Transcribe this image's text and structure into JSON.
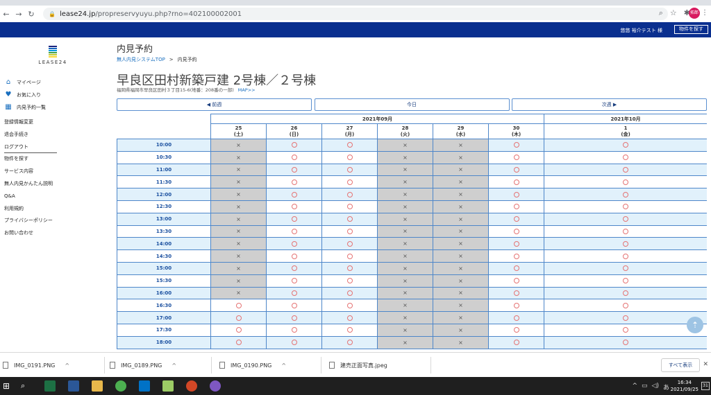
{
  "browser": {
    "url_host": "lease24.jp",
    "url_path": "/propreservyuyu.php?rno=402100002001",
    "profile_initials": "拓郎"
  },
  "site_header": {
    "user_text": "悠悠 裕介テスト 様",
    "search_button": "物件を探す"
  },
  "logo": {
    "text": "LEASE24",
    "colors": [
      "#1a237e",
      "#1565c0",
      "#039be5",
      "#43a047",
      "#c0ca33",
      "#fdd835"
    ]
  },
  "sidebar": {
    "main_items": [
      {
        "label": "マイページ",
        "icon": "home-icon"
      },
      {
        "label": "お気に入り",
        "icon": "heart-icon"
      },
      {
        "label": "内見予約一覧",
        "icon": "building-icon"
      }
    ],
    "links": [
      "登録情報変更",
      "退会手続き",
      "ログアウト",
      "物件を探す",
      "サービス内容",
      "無人内見かんたん説明",
      "Q&A",
      "利用規約",
      "プライバシーポリシー",
      "お問い合わせ"
    ]
  },
  "page": {
    "title": "内見予約",
    "breadcrumb": [
      {
        "label": "無人内見システムTOP"
      },
      {
        "label": "内見予約"
      }
    ],
    "breadcrumb_sep": ">",
    "property_title": "早良区田村新築戸建 2号棟／２号棟",
    "address": "福岡県福岡市早良区田村３丁目15-6(地番：208番の一部)",
    "map_link": "MAP>>"
  },
  "week_nav": {
    "prev": "◀ 前週",
    "today": "今日",
    "next": "次週 ▶"
  },
  "schedule": {
    "months": [
      {
        "label": "2021年09月",
        "span": 6
      },
      {
        "label": "2021年10月",
        "span": 1
      }
    ],
    "days": [
      {
        "date": "25",
        "dow": "(土)"
      },
      {
        "date": "26",
        "dow": "(日)"
      },
      {
        "date": "27",
        "dow": "(月)"
      },
      {
        "date": "28",
        "dow": "(火)"
      },
      {
        "date": "29",
        "dow": "(水)"
      },
      {
        "date": "30",
        "dow": "(木)"
      },
      {
        "date": "1",
        "dow": "(金)"
      }
    ],
    "available_mark": "○",
    "unavailable_mark": "×",
    "rows": [
      {
        "time": "10:00",
        "slots": [
          "x",
          "o",
          "o",
          "x",
          "x",
          "o",
          "o"
        ]
      },
      {
        "time": "10:30",
        "slots": [
          "x",
          "o",
          "o",
          "x",
          "x",
          "o",
          "o"
        ]
      },
      {
        "time": "11:00",
        "slots": [
          "x",
          "o",
          "o",
          "x",
          "x",
          "o",
          "o"
        ]
      },
      {
        "time": "11:30",
        "slots": [
          "x",
          "o",
          "o",
          "x",
          "x",
          "o",
          "o"
        ]
      },
      {
        "time": "12:00",
        "slots": [
          "x",
          "o",
          "o",
          "x",
          "x",
          "o",
          "o"
        ]
      },
      {
        "time": "12:30",
        "slots": [
          "x",
          "o",
          "o",
          "x",
          "x",
          "o",
          "o"
        ]
      },
      {
        "time": "13:00",
        "slots": [
          "x",
          "o",
          "o",
          "x",
          "x",
          "o",
          "o"
        ]
      },
      {
        "time": "13:30",
        "slots": [
          "x",
          "o",
          "o",
          "x",
          "x",
          "o",
          "o"
        ]
      },
      {
        "time": "14:00",
        "slots": [
          "x",
          "o",
          "o",
          "x",
          "x",
          "o",
          "o"
        ]
      },
      {
        "time": "14:30",
        "slots": [
          "x",
          "o",
          "o",
          "x",
          "x",
          "o",
          "o"
        ]
      },
      {
        "time": "15:00",
        "slots": [
          "x",
          "o",
          "o",
          "x",
          "x",
          "o",
          "o"
        ]
      },
      {
        "time": "15:30",
        "slots": [
          "x",
          "o",
          "o",
          "x",
          "x",
          "o",
          "o"
        ]
      },
      {
        "time": "16:00",
        "slots": [
          "x",
          "o",
          "o",
          "x",
          "x",
          "o",
          "o"
        ]
      },
      {
        "time": "16:30",
        "slots": [
          "o",
          "o",
          "o",
          "x",
          "x",
          "o",
          "o"
        ]
      },
      {
        "time": "17:00",
        "slots": [
          "o",
          "o",
          "o",
          "x",
          "x",
          "o",
          "o"
        ]
      },
      {
        "time": "17:30",
        "slots": [
          "o",
          "o",
          "o",
          "x",
          "x",
          "o",
          "o"
        ]
      },
      {
        "time": "18:00",
        "slots": [
          "o",
          "o",
          "o",
          "x",
          "x",
          "o",
          "o"
        ]
      }
    ]
  },
  "downloads": {
    "items": [
      "IMG_0191.PNG",
      "IMG_0189.PNG",
      "IMG_0190.PNG",
      "建売正面写真.jpeg"
    ],
    "show_all": "すべて表示"
  },
  "taskbar": {
    "time": "16:34",
    "date": "2021/09/25",
    "ime": "あ",
    "notification_count": "31"
  }
}
